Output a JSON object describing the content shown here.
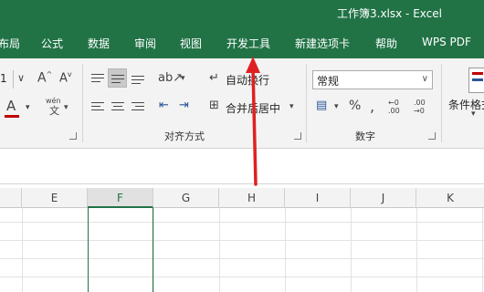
{
  "titlebar": {
    "title": "工作簿3.xlsx  -  Excel"
  },
  "menu": {
    "tabs": [
      "布局",
      "公式",
      "数据",
      "审阅",
      "视图",
      "开发工具",
      "新建选项卡",
      "帮助",
      "WPS PDF"
    ]
  },
  "ribbon": {
    "font_size_value": "1",
    "font_color": "#c00000",
    "phonetic_label": "wén",
    "wrap_text_label": "自动换行",
    "merge_center_label": "合并后居中",
    "alignment_group_label": "对齐方式",
    "number_format_value": "常规",
    "number_group_label": "数字",
    "conditional_format_label": "条件格式"
  },
  "sheet": {
    "columns": [
      "E",
      "F",
      "G",
      "H",
      "I",
      "J",
      "K"
    ],
    "selected_column": "F"
  },
  "annotation": {
    "arrow_color": "#e02020"
  },
  "colors": {
    "accent": "#217346"
  }
}
